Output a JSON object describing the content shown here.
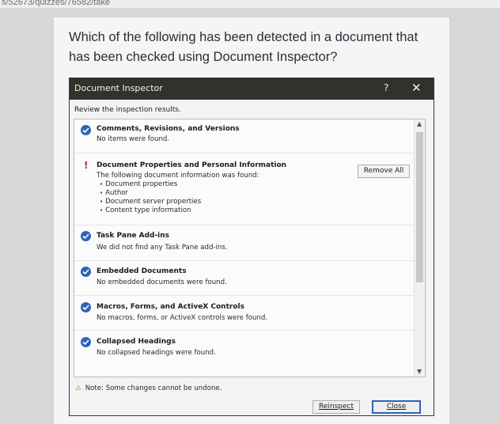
{
  "browser": {
    "url_fragment": "s/52673/quizzes/76582/take"
  },
  "question": {
    "text": "Which of the following has been detected in a document that has been checked using Document Inspector?"
  },
  "dialog": {
    "title": "Document Inspector",
    "help_label": "?",
    "close_label": "✕",
    "subheading": "Review the inspection results.",
    "items": [
      {
        "status": "ok",
        "title": "Comments, Revisions, and Versions",
        "description": "No items were found."
      },
      {
        "status": "warning",
        "title": "Document Properties and Personal Information",
        "description": "The following document information was found:",
        "bullets": [
          "Document properties",
          "Author",
          "Document server properties",
          "Content type information"
        ],
        "action_label": "Remove All"
      },
      {
        "status": "ok",
        "title": "Task Pane Add-ins",
        "description": "We did not find any Task Pane add-ins."
      },
      {
        "status": "ok",
        "title": "Embedded Documents",
        "description": "No embedded documents were found."
      },
      {
        "status": "ok",
        "title": "Macros, Forms, and ActiveX Controls",
        "description": "No macros, forms, or ActiveX controls were found."
      },
      {
        "status": "ok",
        "title": "Collapsed Headings",
        "description": "No collapsed headings were found."
      }
    ],
    "note": "Note: Some changes cannot be undone.",
    "reinspect_label": "Reinspect",
    "close_button_label": "Close"
  },
  "icons": {
    "ok": "check-circle-icon",
    "warning": "exclamation-icon",
    "note": "warning-icon"
  },
  "colors": {
    "titlebar": "#33312c",
    "check": "#2f62b8",
    "warning": "#c8231b"
  }
}
